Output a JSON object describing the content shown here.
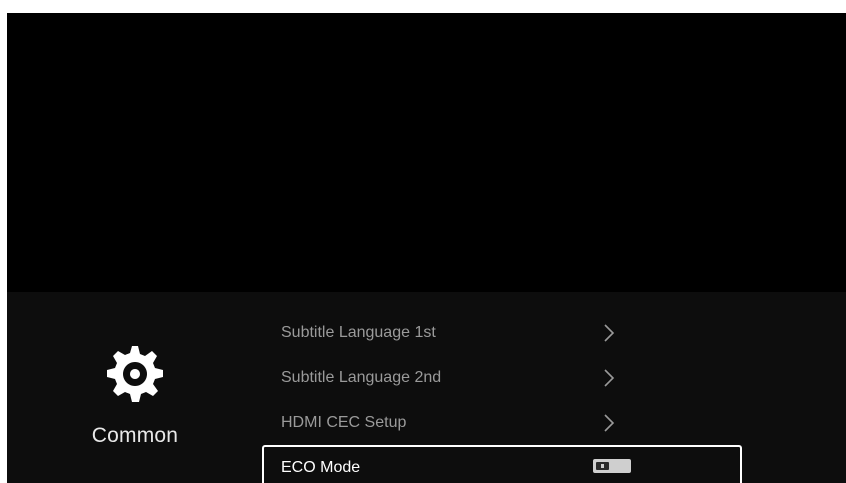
{
  "category": {
    "label": "Common",
    "icon": "gear-icon"
  },
  "menu": {
    "items": [
      {
        "label": "Subtitle Language 1st",
        "control": "chevron-right-icon"
      },
      {
        "label": "Subtitle Language 2nd",
        "control": "chevron-right-icon"
      },
      {
        "label": "HDMI CEC Setup",
        "control": "chevron-right-icon"
      },
      {
        "label": "ECO Mode",
        "control": "toggle",
        "toggle_state": "off",
        "selected": true
      }
    ]
  },
  "colors": {
    "background": "#000000",
    "panel": "#0d0d0d",
    "text_dim": "#9a9a9a",
    "text_bright": "#ffffff",
    "focus_border": "#ffffff"
  }
}
